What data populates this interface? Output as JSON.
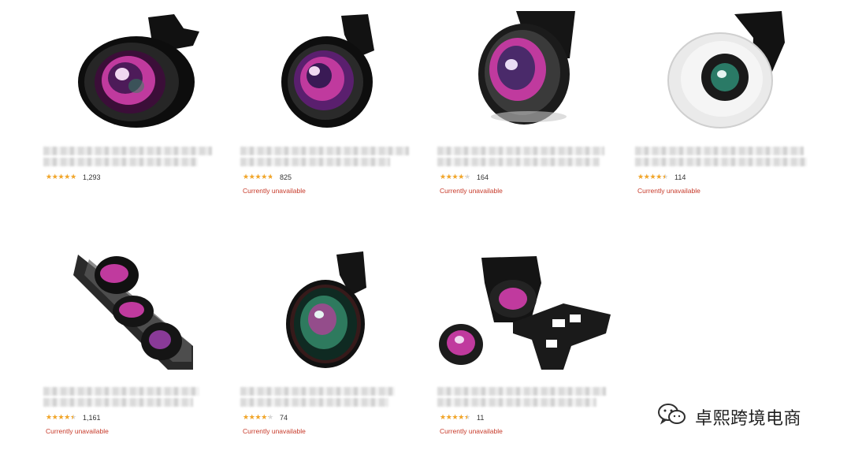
{
  "products": [
    {
      "stars": "★★★★★",
      "rating": 4.5,
      "count": "1,293",
      "status": ""
    },
    {
      "stars": "★★★★★",
      "rating": 4.2,
      "count": "825",
      "status": "Currently unavailable"
    },
    {
      "stars": "★★★★★",
      "rating": 3.8,
      "count": "164",
      "status": "Currently unavailable"
    },
    {
      "stars": "★★★★★",
      "rating": 4.0,
      "count": "114",
      "status": "Currently unavailable"
    },
    {
      "stars": "★★★★★",
      "rating": 4.0,
      "count": "1,161",
      "status": "Currently unavailable"
    },
    {
      "stars": "★★★★★",
      "rating": 3.8,
      "count": "74",
      "status": "Currently unavailable"
    },
    {
      "stars": "★★★★★",
      "rating": 4.0,
      "count": "11",
      "status": "Currently unavailable"
    }
  ],
  "watermark": {
    "text": "卓熙跨境电商",
    "icon": "wechat-icon"
  },
  "colors": {
    "star": "#f3a628",
    "status": "#c73a2a",
    "lens": "#c03a9e"
  }
}
